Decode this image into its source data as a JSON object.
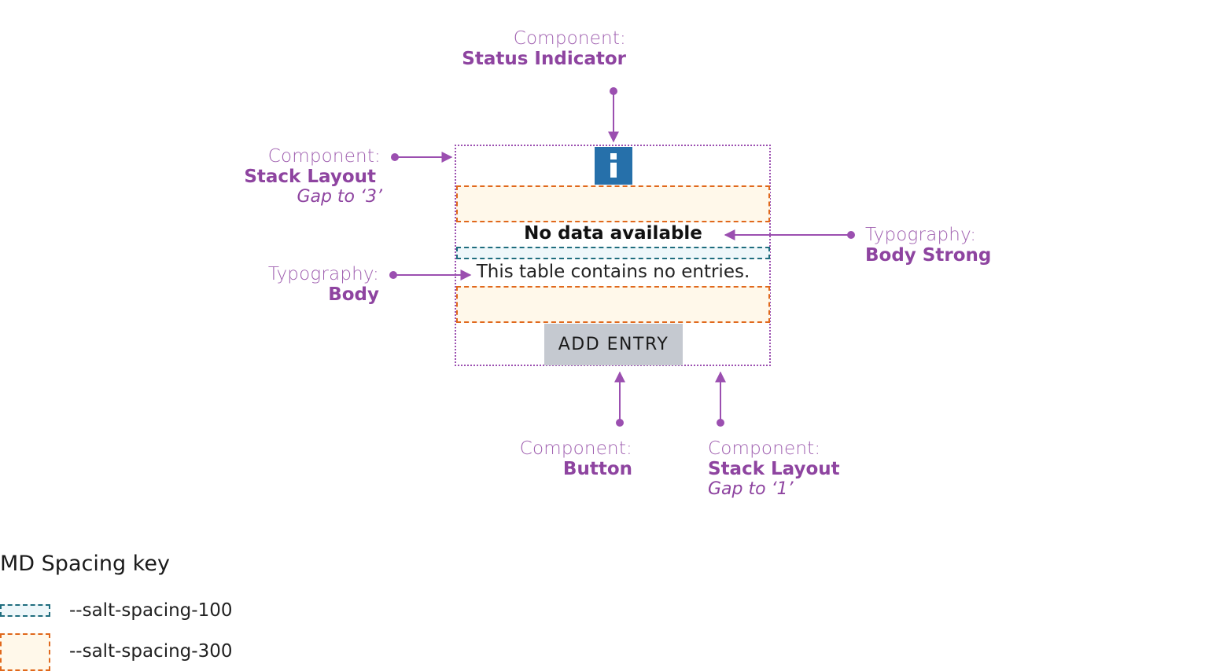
{
  "annotations": {
    "status_indicator": {
      "kind": "Component:",
      "name": "Status Indicator"
    },
    "stack_layout_outer": {
      "kind": "Component:",
      "name": "Stack Layout",
      "note": "Gap to ‘3’"
    },
    "typography_body_strong": {
      "kind": "Typography:",
      "name": "Body Strong"
    },
    "typography_body": {
      "kind": "Typography:",
      "name": "Body"
    },
    "button": {
      "kind": "Component:",
      "name": "Button"
    },
    "stack_layout_inner": {
      "kind": "Component:",
      "name": "Stack Layout",
      "note": "Gap to ‘1’"
    }
  },
  "empty_state": {
    "status_icon": "info-icon",
    "heading": "No data available",
    "body": "This table contains no entries.",
    "button_label": "ADD ENTRY"
  },
  "spacing_key": {
    "title": "MD Spacing key",
    "items": [
      {
        "label": "--salt-spacing-100",
        "color": "#1f6d7e",
        "fill": "#eef7fa"
      },
      {
        "label": "--salt-spacing-300",
        "color": "#e0681c",
        "fill": "#fff8ea"
      }
    ]
  },
  "colors": {
    "annotation": "#8e44a0",
    "status_info": "#2670aa",
    "button_bg": "#c5c9d0"
  }
}
